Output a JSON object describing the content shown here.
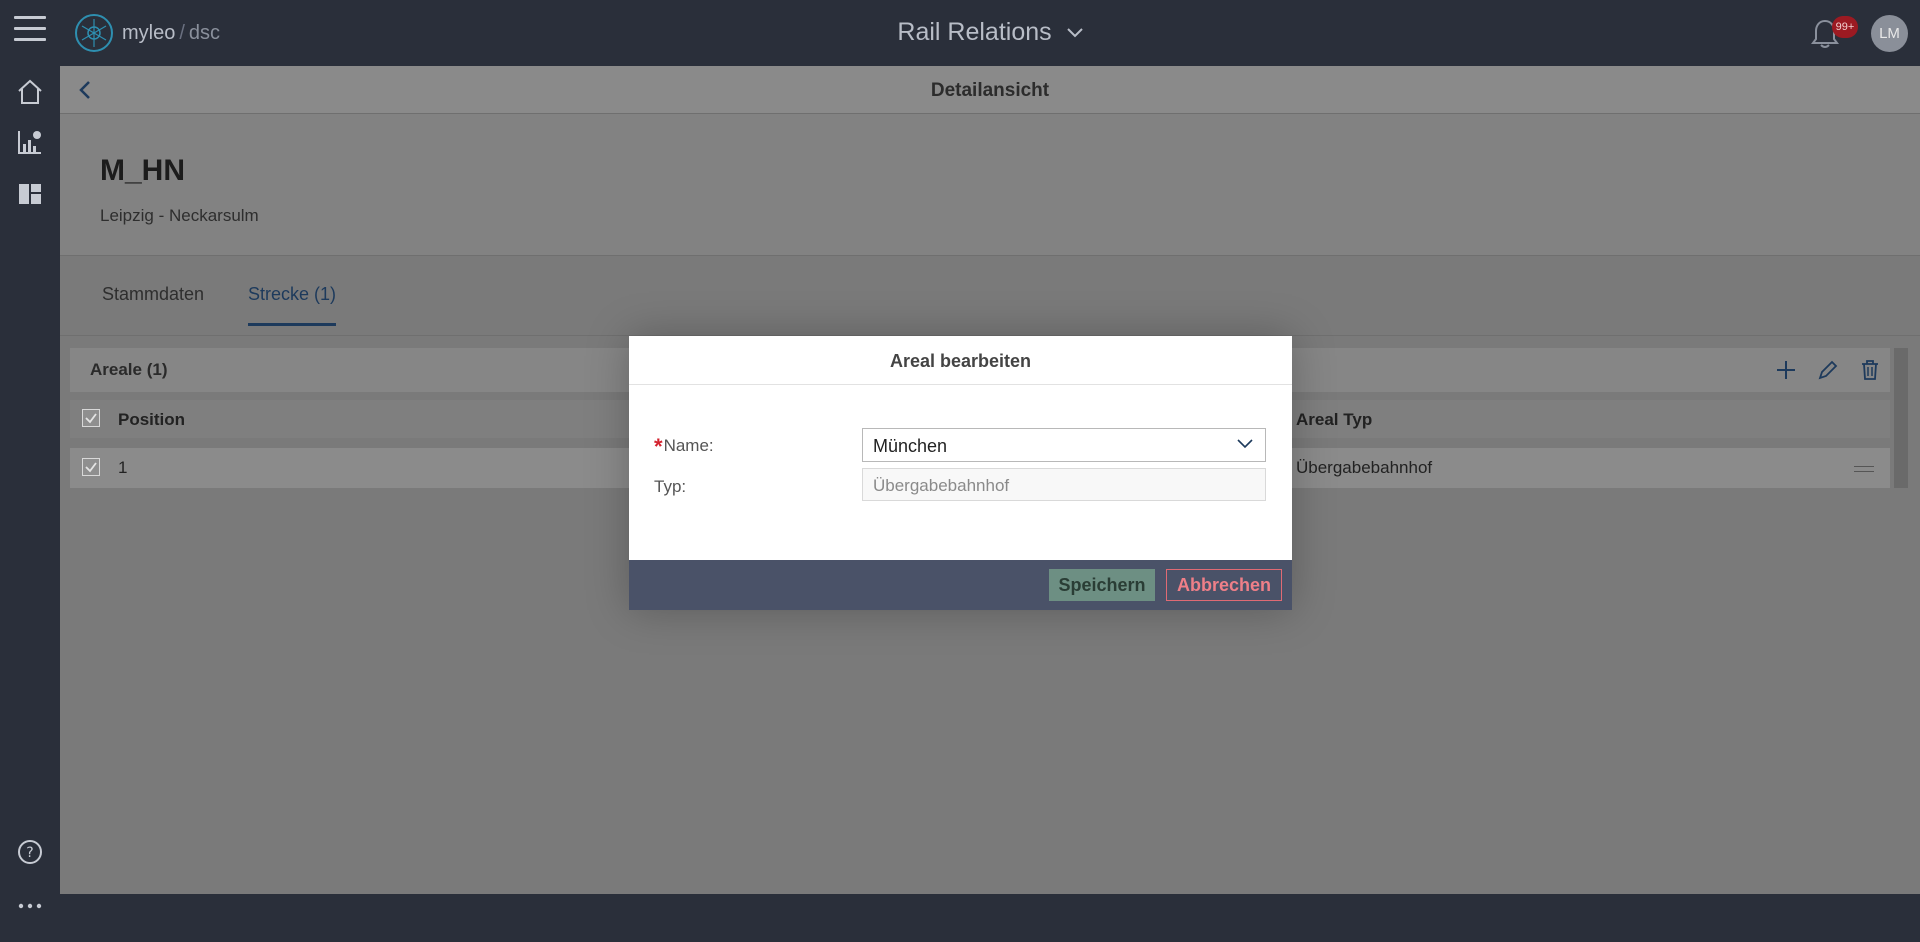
{
  "header": {
    "logo_brand": "myleo",
    "logo_separator": "/",
    "logo_product": "dsc",
    "app_title": "Rail Relations",
    "notification_badge": "99+",
    "user_initials": "LM"
  },
  "subheader": {
    "title": "Detailansicht"
  },
  "record": {
    "id": "M_HN",
    "subtitle": "Leipzig - Neckarsulm"
  },
  "tabs": [
    {
      "label": "Stammdaten"
    },
    {
      "label": "Strecke (1)"
    }
  ],
  "panel": {
    "title": "Areale (1)",
    "columns": [
      "Position",
      "Areal Typ"
    ],
    "rows": [
      {
        "position": "1",
        "areal_typ": "Übergabebahnhof"
      }
    ]
  },
  "dialog": {
    "title": "Areal bearbeiten",
    "required_mark": "*",
    "name_label": "Name:",
    "name_value": "München",
    "type_label": "Typ:",
    "type_value": "Übergabebahnhof",
    "save_label": "Speichern",
    "cancel_label": "Abbrechen"
  },
  "colors": {
    "topbar": "#2a2f3a",
    "active_tab": "#1d3a5c",
    "required": "#d3232f",
    "save_button": "#6d8f83",
    "cancel_button": "#e06a74",
    "dialog_footer": "#4a5268"
  }
}
